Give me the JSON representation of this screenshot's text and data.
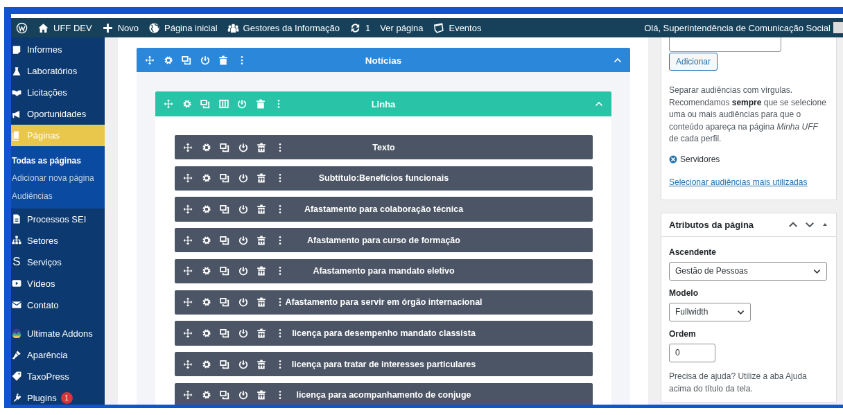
{
  "admin_bar": {
    "items": [
      {
        "kind": "logo"
      },
      {
        "kind": "link",
        "label": "UFF DEV"
      },
      {
        "kind": "link",
        "label": "Novo"
      },
      {
        "kind": "link",
        "label": "Página inicial"
      },
      {
        "kind": "link",
        "label": "Gestores da Informação"
      },
      {
        "kind": "link",
        "label": "1"
      },
      {
        "kind": "link",
        "label": "Ver página"
      },
      {
        "kind": "link",
        "label": "Eventos"
      }
    ],
    "greeting": "Olá, Superintendência de Comunicação Social"
  },
  "sidebar": {
    "items": [
      {
        "label": "Informes",
        "selected": false
      },
      {
        "label": "Laboratórios",
        "selected": false
      },
      {
        "label": "Licitações",
        "selected": false
      },
      {
        "label": "Oportunidades",
        "selected": false
      },
      {
        "label": "Páginas",
        "selected": true,
        "children": [
          {
            "label": "Todas as páginas",
            "selected": true
          },
          {
            "label": "Adicionar nova página",
            "selected": false
          },
          {
            "label": "Audiências",
            "selected": false
          }
        ]
      },
      {
        "label": "Processos SEI",
        "selected": false
      },
      {
        "label": "Setores",
        "selected": false
      },
      {
        "glyph": "S",
        "label": "Serviços",
        "selected": false
      },
      {
        "label": "Vídeos",
        "selected": false
      },
      {
        "label": "Contato",
        "selected": false
      },
      {
        "label": "Ultimate Addons",
        "selected": false
      },
      {
        "label": "Aparência",
        "selected": false
      },
      {
        "label": "TaxoPress",
        "selected": false
      },
      {
        "label": "Plugins",
        "selected": false,
        "badge": "1"
      }
    ]
  },
  "builder": {
    "section": {
      "title": "Notícias",
      "expanded": true,
      "row": {
        "title": "Linha",
        "expanded": true,
        "modules": [
          {
            "title": "Texto"
          },
          {
            "title": "Subtítulo:Benefícios funcionais"
          },
          {
            "title": "Afastamento para colaboração técnica"
          },
          {
            "title": "Afastamento para curso de formação"
          },
          {
            "title": "Afastamento para mandato eletivo"
          },
          {
            "title": "Afastamento para servir em órgão internacional"
          },
          {
            "title": "licença para desempenho mandato classista"
          },
          {
            "title": "licença para tratar de interesses particulares"
          },
          {
            "title": "licença para acompanhamento de conjuge"
          }
        ]
      }
    }
  },
  "audiences_panel": {
    "add_button": "Adicionar",
    "help": "Separar audiências com vírgulas. Recomendamos **sempre** que se selecione uma ou mais audiências para que o conteúdo apareça na página *Minha UFF* de cada perfil.",
    "tags": [
      {
        "label": "Servidores"
      }
    ],
    "link": "Selecionar audiências mais utilizadas"
  },
  "attributes_panel": {
    "title": "Atributos da página",
    "expanded": true,
    "fields": [
      {
        "kind": "select",
        "label": "Ascendente",
        "value": "Gestão de Pessoas"
      },
      {
        "kind": "select",
        "label": "Modelo",
        "value": "Fullwidth"
      },
      {
        "kind": "input",
        "label": "Ordem",
        "value": "0"
      }
    ],
    "help": "Precisa de ajuda? Utilize a aba Ajuda acima do título da tela."
  }
}
